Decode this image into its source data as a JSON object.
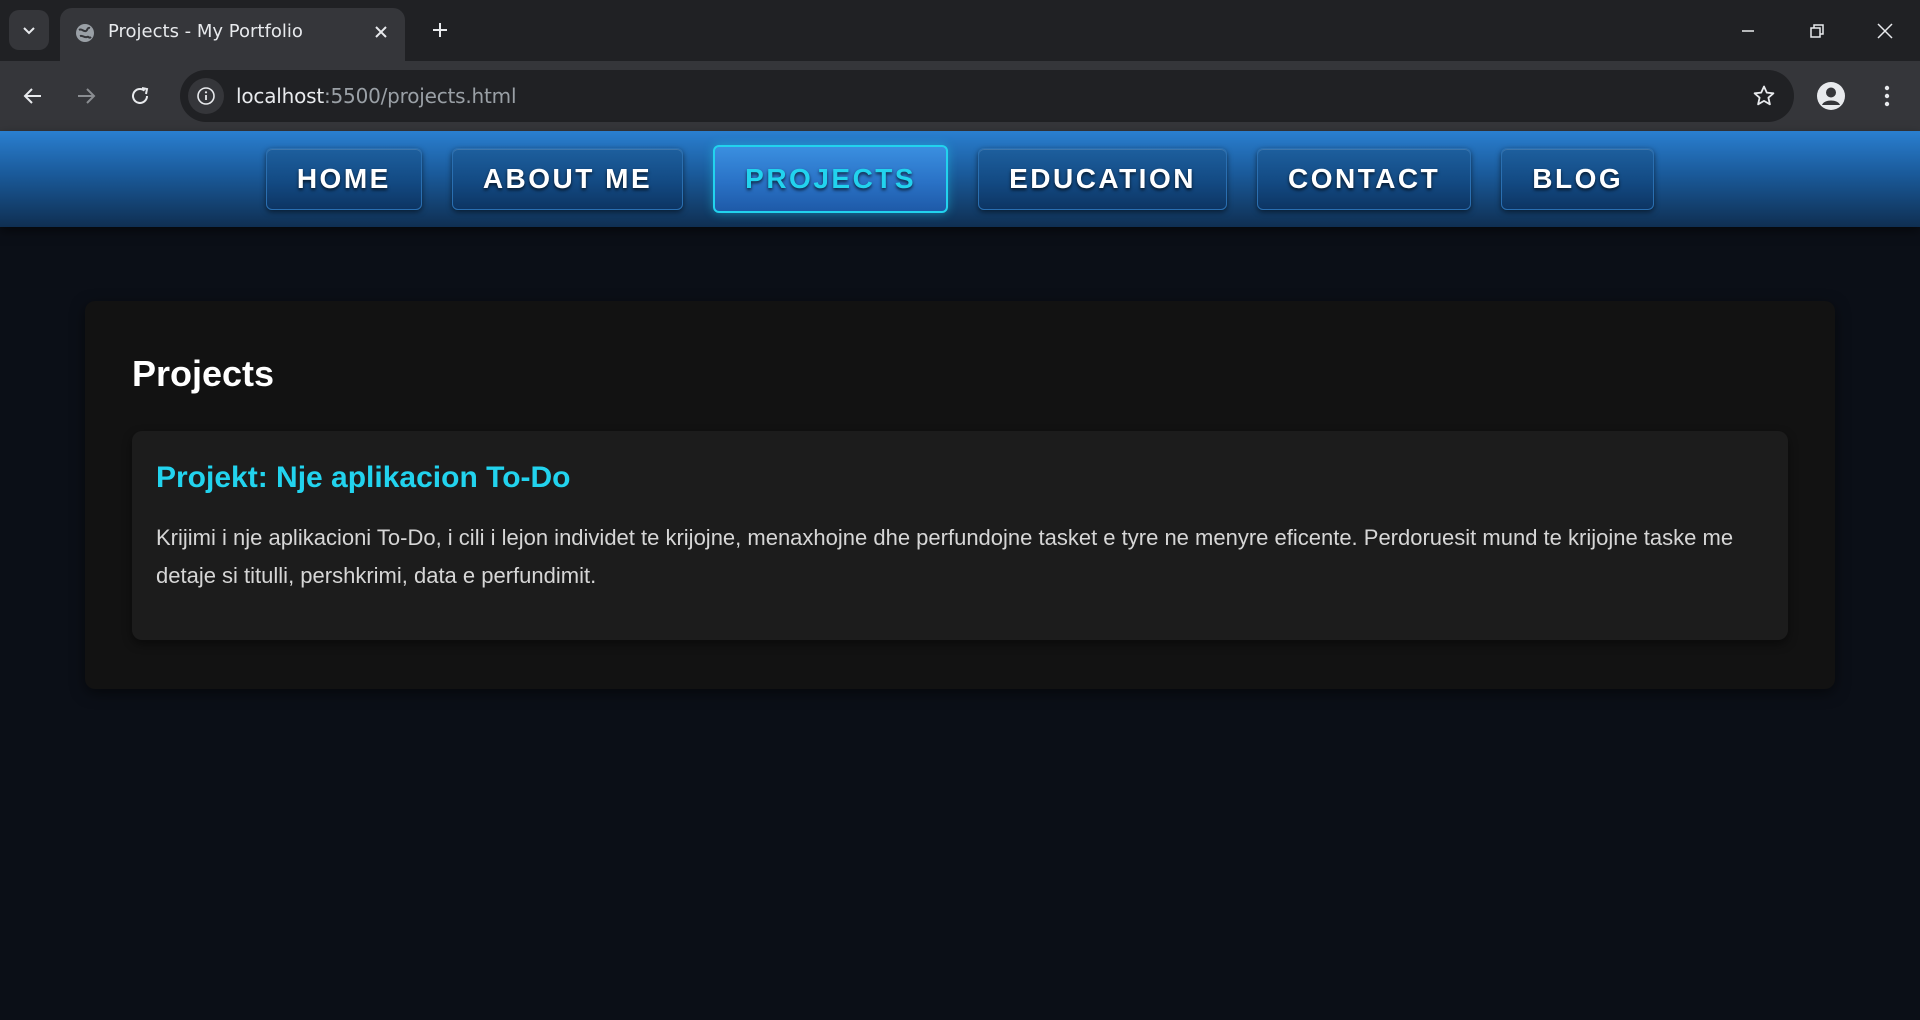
{
  "browser": {
    "tab_title": "Projects - My Portfolio",
    "url_host": "localhost",
    "url_rest": ":5500/projects.html"
  },
  "nav": {
    "items": [
      {
        "label": "HOME"
      },
      {
        "label": "ABOUT ME"
      },
      {
        "label": "PROJECTS",
        "active": true
      },
      {
        "label": "EDUCATION"
      },
      {
        "label": "CONTACT"
      },
      {
        "label": "BLOG"
      }
    ]
  },
  "main": {
    "heading": "Projects",
    "projects": [
      {
        "title": "Projekt: Nje aplikacion To-Do",
        "description": "Krijimi i nje aplikacioni To-Do, i cili i lejon individet te krijojne, menaxhojne dhe perfundojne tasket e tyre ne menyre eficente. Perdoruesit mund te krijojne taske me detaje si titulli, pershkrimi, data e perfundimit."
      }
    ]
  },
  "colors": {
    "accent": "#22d3ee",
    "nav_gradient_top": "#2a7fd0",
    "page_background": "#0b0f17",
    "card_background": "#1c1c1c"
  }
}
